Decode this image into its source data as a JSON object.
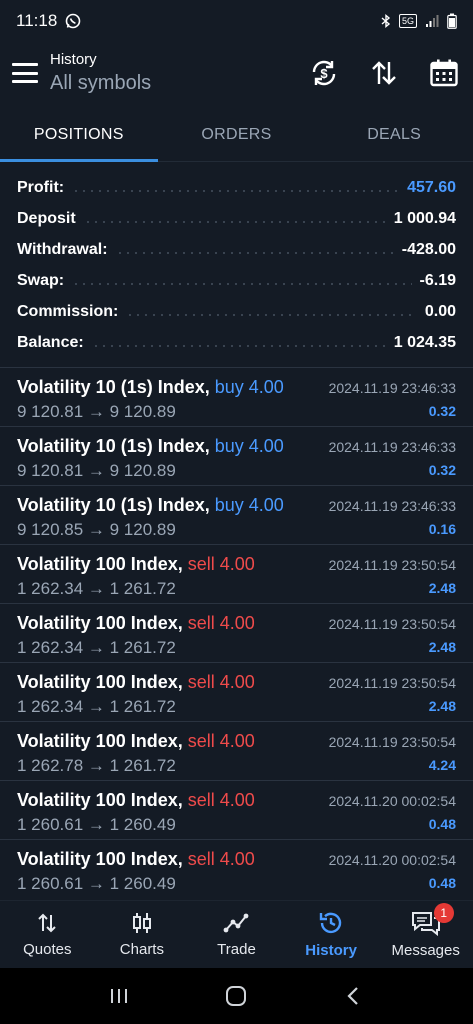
{
  "status_bar": {
    "time": "11:18",
    "network_badge": "5G"
  },
  "header": {
    "title": "History",
    "subtitle": "All symbols"
  },
  "tabs": [
    {
      "label": "POSITIONS",
      "active": true
    },
    {
      "label": "ORDERS",
      "active": false
    },
    {
      "label": "DEALS",
      "active": false
    }
  ],
  "summary": {
    "profit": {
      "label": "Profit:",
      "value": "457.60"
    },
    "deposit": {
      "label": "Deposit",
      "value": "1 000.94"
    },
    "withdrawal": {
      "label": "Withdrawal:",
      "value": "-428.00"
    },
    "swap": {
      "label": "Swap:",
      "value": "-6.19"
    },
    "commission": {
      "label": "Commission:",
      "value": "0.00"
    },
    "balance": {
      "label": "Balance:",
      "value": "1 024.35"
    }
  },
  "deals": [
    {
      "symbol": "Volatility 10 (1s) Index,",
      "direction": "buy 4.00",
      "prices": "9 120.81 → 9 120.89",
      "time": "2024.11.19 23:46:33",
      "profit": "0.32"
    },
    {
      "symbol": "Volatility 10 (1s) Index,",
      "direction": "buy 4.00",
      "prices": "9 120.81 → 9 120.89",
      "time": "2024.11.19 23:46:33",
      "profit": "0.32"
    },
    {
      "symbol": "Volatility 10 (1s) Index,",
      "direction": "buy 4.00",
      "prices": "9 120.85 → 9 120.89",
      "time": "2024.11.19 23:46:33",
      "profit": "0.16"
    },
    {
      "symbol": "Volatility 100 Index,",
      "direction": "sell 4.00",
      "prices": "1 262.34 → 1 261.72",
      "time": "2024.11.19 23:50:54",
      "profit": "2.48"
    },
    {
      "symbol": "Volatility 100 Index,",
      "direction": "sell 4.00",
      "prices": "1 262.34 → 1 261.72",
      "time": "2024.11.19 23:50:54",
      "profit": "2.48"
    },
    {
      "symbol": "Volatility 100 Index,",
      "direction": "sell 4.00",
      "prices": "1 262.34 → 1 261.72",
      "time": "2024.11.19 23:50:54",
      "profit": "2.48"
    },
    {
      "symbol": "Volatility 100 Index,",
      "direction": "sell 4.00",
      "prices": "1 262.78 → 1 261.72",
      "time": "2024.11.19 23:50:54",
      "profit": "4.24"
    },
    {
      "symbol": "Volatility 100 Index,",
      "direction": "sell 4.00",
      "prices": "1 260.61 → 1 260.49",
      "time": "2024.11.20 00:02:54",
      "profit": "0.48"
    },
    {
      "symbol": "Volatility 100 Index,",
      "direction": "sell 4.00",
      "prices": "1 260.61 → 1 260.49",
      "time": "2024.11.20 00:02:54",
      "profit": "0.48"
    }
  ],
  "bottom_nav": [
    {
      "label": "Quotes",
      "icon": "arrows-updown-icon",
      "active": false
    },
    {
      "label": "Charts",
      "icon": "candlestick-icon",
      "active": false
    },
    {
      "label": "Trade",
      "icon": "trend-line-icon",
      "active": false
    },
    {
      "label": "History",
      "icon": "history-clock-icon",
      "active": true
    },
    {
      "label": "Messages",
      "icon": "chat-bubbles-icon",
      "active": false,
      "badge": "1"
    }
  ],
  "colors": {
    "background": "#141b25",
    "accent": "#4a9aff",
    "sell": "#ef4b4b",
    "muted": "#9aa6b5"
  }
}
